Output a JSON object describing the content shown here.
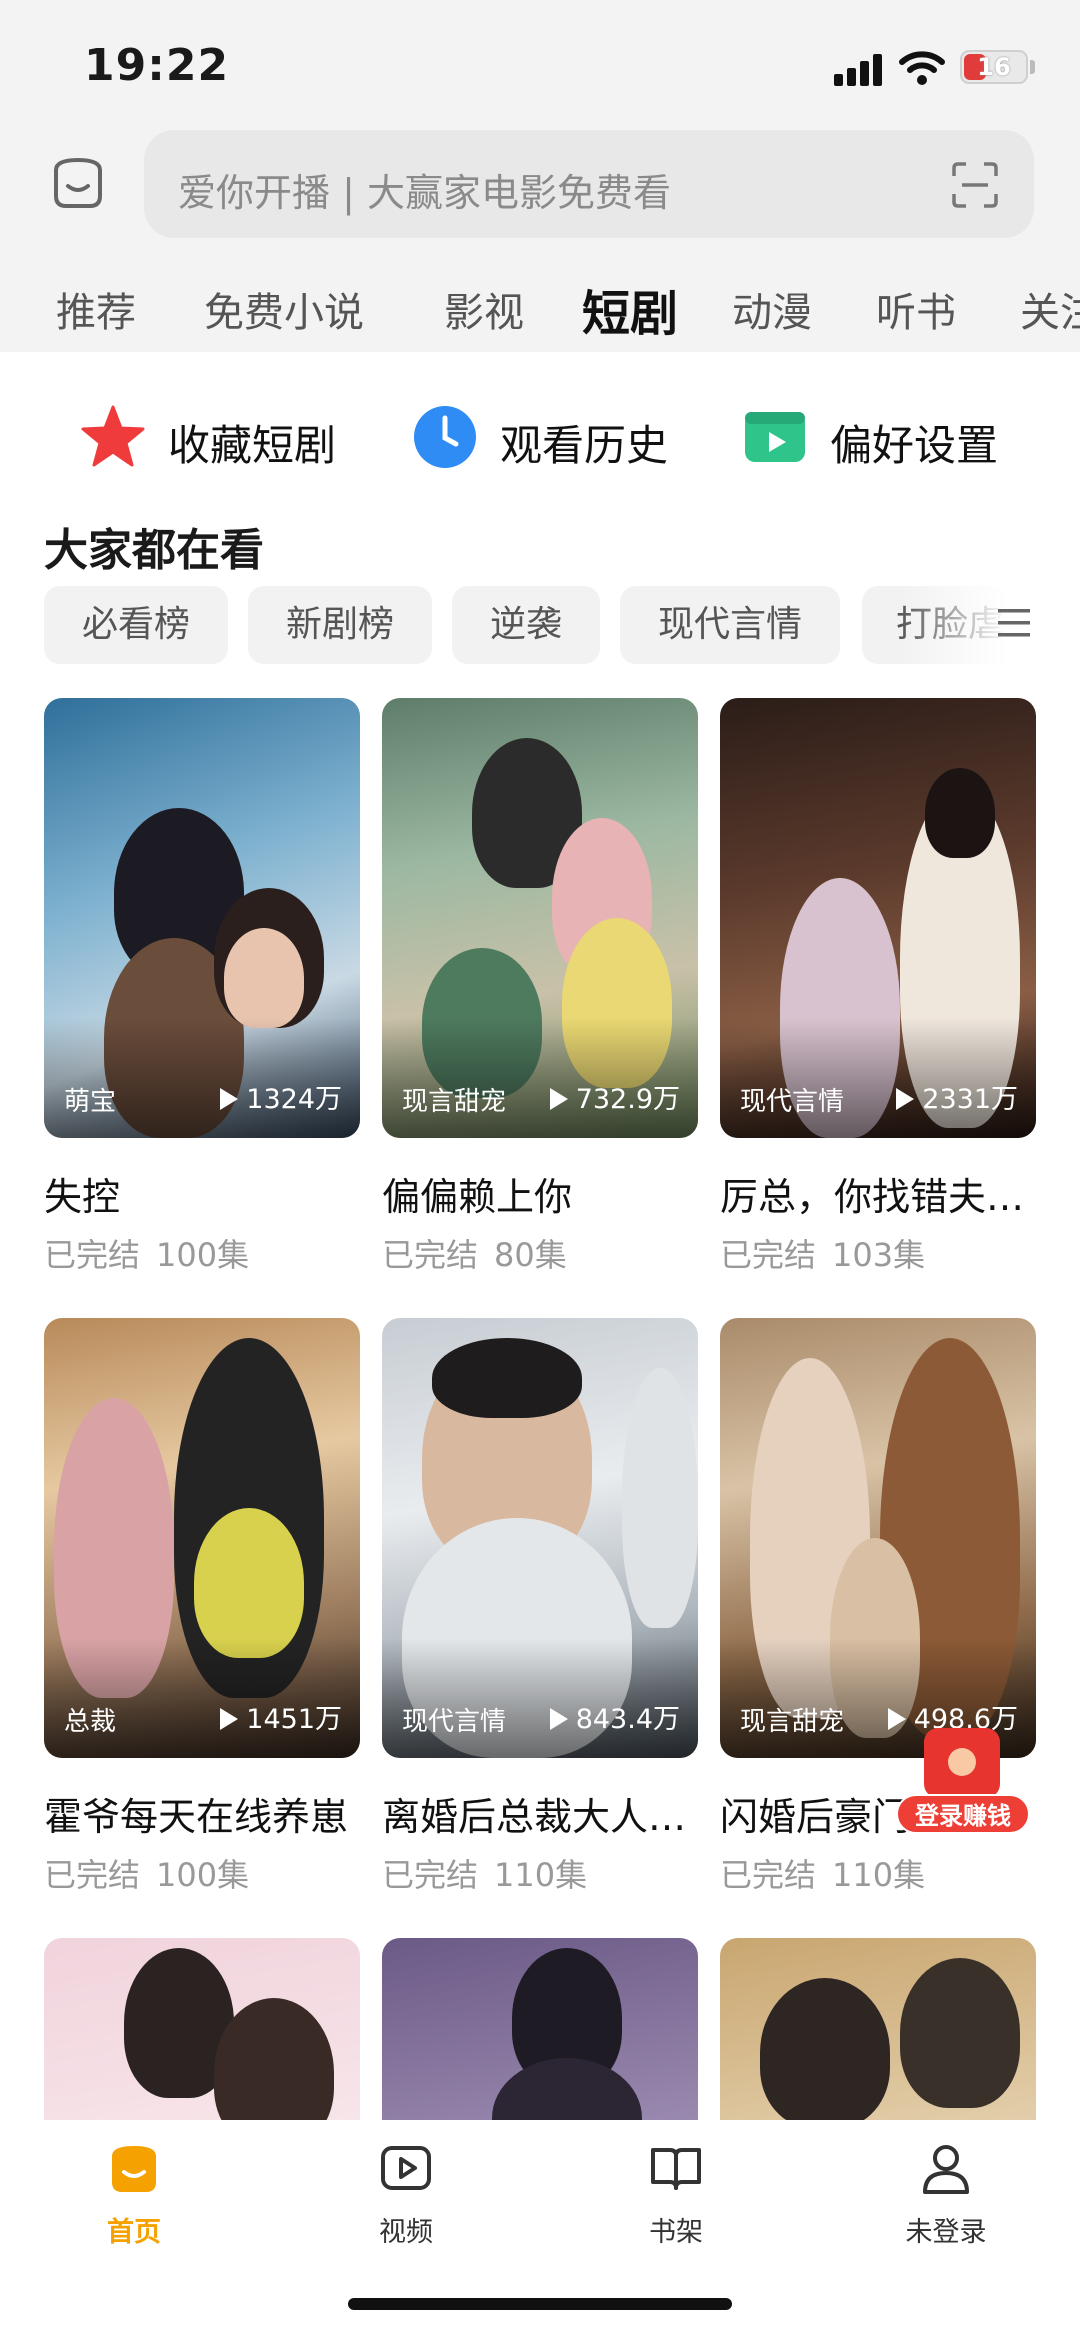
{
  "status_bar": {
    "time": "19:22",
    "battery": "16"
  },
  "search": {
    "placeholder": "爱你开播 | 大赢家电影免费看"
  },
  "top_tabs": [
    "推荐",
    "免费小说",
    "影视",
    "短剧",
    "动漫",
    "听书",
    "关注"
  ],
  "active_tab": "短剧",
  "quick_actions": [
    {
      "label": "收藏短剧",
      "icon": "star-icon"
    },
    {
      "label": "观看历史",
      "icon": "clock-icon"
    },
    {
      "label": "偏好设置",
      "icon": "video-settings-icon"
    }
  ],
  "section_title": "大家都在看",
  "filter_chips": [
    "必看榜",
    "新剧榜",
    "逆袭",
    "现代言情",
    "打脸虐渣"
  ],
  "dramas": [
    {
      "title": "失控",
      "tag": "萌宝",
      "views": "1324万",
      "status": "已完结",
      "episodes": "100集"
    },
    {
      "title": "偏偏赖上你",
      "tag": "现言甜宠",
      "views": "732.9万",
      "status": "已完结",
      "episodes": "80集"
    },
    {
      "title": "厉总，你找错夫人了",
      "tag": "现代言情",
      "views": "2331万",
      "status": "已完结",
      "episodes": "103集"
    },
    {
      "title": "霍爷每天在线养崽",
      "tag": "总裁",
      "views": "1451万",
      "status": "已完结",
      "episodes": "100集"
    },
    {
      "title": "离婚后总裁大人后悔了",
      "tag": "现代言情",
      "views": "843.4万",
      "status": "已完结",
      "episodes": "110集"
    },
    {
      "title": "闪婚后豪门老公马甲藏不住",
      "tag": "现言甜宠",
      "views": "498.6万",
      "status": "已完结",
      "episodes": "110集"
    }
  ],
  "promo": {
    "label": "登录赚钱"
  },
  "bottom_nav": [
    {
      "label": "首页",
      "icon": "home-icon",
      "active": true
    },
    {
      "label": "视频",
      "icon": "video-icon",
      "active": false
    },
    {
      "label": "书架",
      "icon": "bookshelf-icon",
      "active": false
    },
    {
      "label": "未登录",
      "icon": "user-icon",
      "active": false
    }
  ],
  "colors": {
    "accent": "#f5a100",
    "promo_red": "#e8342f"
  }
}
